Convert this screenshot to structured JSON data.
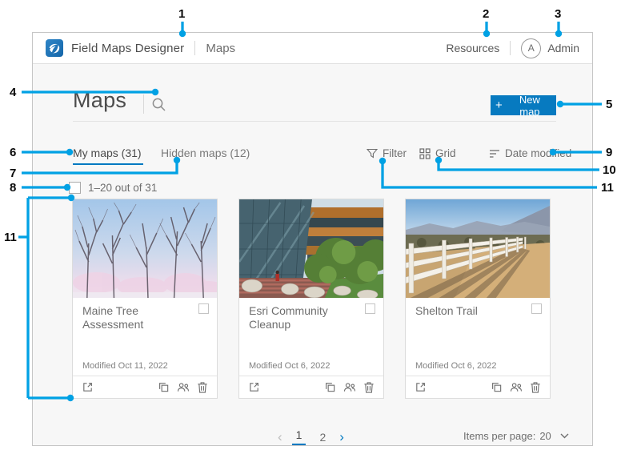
{
  "colors": {
    "accent_blue": "#007ac2",
    "button_blue": "#077ac0",
    "callout_blue": "#00a1e4"
  },
  "callouts": {
    "c1": "1",
    "c2": "2",
    "c3": "3",
    "c4": "4",
    "c5": "5",
    "c6": "6",
    "c7": "7",
    "c8": "8",
    "c9": "9",
    "c10": "10",
    "c11_right": "11",
    "c11_left": "11"
  },
  "header": {
    "app_title": "Field Maps Designer",
    "nav_item": "Maps",
    "resources_label": "Resources",
    "avatar_initial": "A",
    "user_name": "Admin"
  },
  "content": {
    "page_title": "Maps",
    "new_map_plus": "+",
    "new_map_label": "New map",
    "tabs": {
      "my_maps": "My maps (31)",
      "hidden_maps": "Hidden maps (12)"
    },
    "controls": {
      "filter_label": "Filter",
      "grid_label": "Grid",
      "sort_label": "Date modified"
    },
    "selection_label": "1–20 out of 31"
  },
  "cards": [
    {
      "title": "Maine Tree Assessment",
      "modified": "Modified Oct 11, 2022"
    },
    {
      "title": "Esri Community Cleanup",
      "modified": "Modified Oct 6, 2022"
    },
    {
      "title": "Shelton Trail",
      "modified": "Modified Oct 6, 2022"
    }
  ],
  "pagination": {
    "prev": "‹",
    "page1": "1",
    "page2": "2",
    "next": "›"
  },
  "footer": {
    "items_per_page_label": "Items per page:",
    "items_per_page_value": "20"
  }
}
